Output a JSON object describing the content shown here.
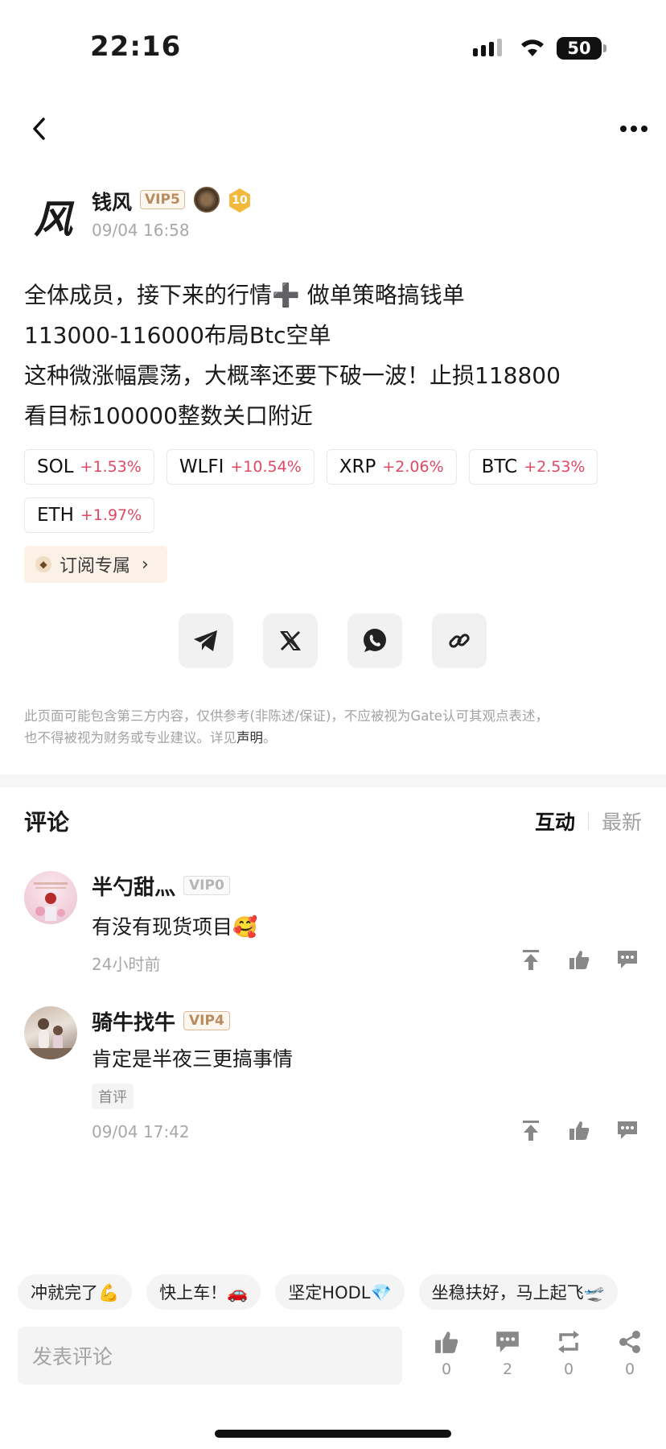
{
  "status_bar": {
    "time": "22:16",
    "battery": "50"
  },
  "author": {
    "avatar_glyph": "风",
    "name": "钱风",
    "vip": "VIP5",
    "level": "10",
    "time": "09/04 16:58"
  },
  "post": {
    "line1": "全体成员，接下来的行情➕ 做单策略搞钱单",
    "line2": "113000-116000布局Btc空单",
    "line3": "这种微涨幅震荡，大概率还要下破一波！止损118800",
    "line4": "看目标100000整数关口附近"
  },
  "tickers": [
    {
      "symbol": "SOL",
      "change": "+1.53%"
    },
    {
      "symbol": "WLFI",
      "change": "+10.54%"
    },
    {
      "symbol": "XRP",
      "change": "+2.06%"
    },
    {
      "symbol": "BTC",
      "change": "+2.53%"
    },
    {
      "symbol": "ETH",
      "change": "+1.97%"
    }
  ],
  "subscribe": {
    "label": "订阅专属"
  },
  "share_icons": [
    "telegram-icon",
    "x-icon",
    "whatsapp-icon",
    "link-icon"
  ],
  "disclaimer": {
    "line1": "此页面可能包含第三方内容，仅供参考(非陈述/保证)，不应被视为Gate认可其观点表述，",
    "line2_prefix": "也不得被视为财务或专业建议。详见",
    "link": "声明",
    "suffix": "。"
  },
  "comments_section": {
    "title": "评论",
    "sort_active": "互动",
    "sort_inactive": "最新"
  },
  "comments": [
    {
      "name": "半勺甜灬",
      "vip": "VIP0",
      "text": "有没有现货项目🥰",
      "tag": "",
      "time": "24小时前"
    },
    {
      "name": "骑牛找牛",
      "vip": "VIP4",
      "text": "肯定是半夜三更搞事情",
      "tag": "首评",
      "time": "09/04 17:42"
    }
  ],
  "quick_replies": [
    "冲就完了💪",
    "快上车！🚗",
    "坚定HODL💎",
    "坐稳扶好，马上起飞🛫"
  ],
  "bottom_bar": {
    "input_placeholder": "发表评论",
    "like_count": "0",
    "comment_count": "2",
    "repost_count": "0",
    "share_count": "0"
  },
  "colors": {
    "positive": "#e04863",
    "vip_gold": "#b98c5f",
    "level_badge": "#f2b93c"
  }
}
